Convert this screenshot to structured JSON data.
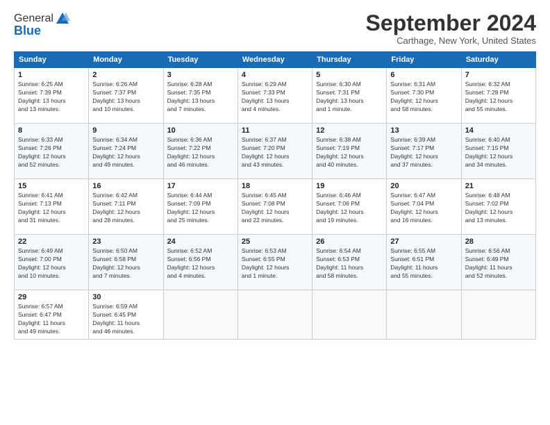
{
  "header": {
    "logo_general": "General",
    "logo_blue": "Blue",
    "month_title": "September 2024",
    "location": "Carthage, New York, United States"
  },
  "weekdays": [
    "Sunday",
    "Monday",
    "Tuesday",
    "Wednesday",
    "Thursday",
    "Friday",
    "Saturday"
  ],
  "weeks": [
    [
      {
        "day": "1",
        "info": "Sunrise: 6:25 AM\nSunset: 7:39 PM\nDaylight: 13 hours\nand 13 minutes."
      },
      {
        "day": "2",
        "info": "Sunrise: 6:26 AM\nSunset: 7:37 PM\nDaylight: 13 hours\nand 10 minutes."
      },
      {
        "day": "3",
        "info": "Sunrise: 6:28 AM\nSunset: 7:35 PM\nDaylight: 13 hours\nand 7 minutes."
      },
      {
        "day": "4",
        "info": "Sunrise: 6:29 AM\nSunset: 7:33 PM\nDaylight: 13 hours\nand 4 minutes."
      },
      {
        "day": "5",
        "info": "Sunrise: 6:30 AM\nSunset: 7:31 PM\nDaylight: 13 hours\nand 1 minute."
      },
      {
        "day": "6",
        "info": "Sunrise: 6:31 AM\nSunset: 7:30 PM\nDaylight: 12 hours\nand 58 minutes."
      },
      {
        "day": "7",
        "info": "Sunrise: 6:32 AM\nSunset: 7:28 PM\nDaylight: 12 hours\nand 55 minutes."
      }
    ],
    [
      {
        "day": "8",
        "info": "Sunrise: 6:33 AM\nSunset: 7:26 PM\nDaylight: 12 hours\nand 52 minutes."
      },
      {
        "day": "9",
        "info": "Sunrise: 6:34 AM\nSunset: 7:24 PM\nDaylight: 12 hours\nand 49 minutes."
      },
      {
        "day": "10",
        "info": "Sunrise: 6:36 AM\nSunset: 7:22 PM\nDaylight: 12 hours\nand 46 minutes."
      },
      {
        "day": "11",
        "info": "Sunrise: 6:37 AM\nSunset: 7:20 PM\nDaylight: 12 hours\nand 43 minutes."
      },
      {
        "day": "12",
        "info": "Sunrise: 6:38 AM\nSunset: 7:19 PM\nDaylight: 12 hours\nand 40 minutes."
      },
      {
        "day": "13",
        "info": "Sunrise: 6:39 AM\nSunset: 7:17 PM\nDaylight: 12 hours\nand 37 minutes."
      },
      {
        "day": "14",
        "info": "Sunrise: 6:40 AM\nSunset: 7:15 PM\nDaylight: 12 hours\nand 34 minutes."
      }
    ],
    [
      {
        "day": "15",
        "info": "Sunrise: 6:41 AM\nSunset: 7:13 PM\nDaylight: 12 hours\nand 31 minutes."
      },
      {
        "day": "16",
        "info": "Sunrise: 6:42 AM\nSunset: 7:11 PM\nDaylight: 12 hours\nand 28 minutes."
      },
      {
        "day": "17",
        "info": "Sunrise: 6:44 AM\nSunset: 7:09 PM\nDaylight: 12 hours\nand 25 minutes."
      },
      {
        "day": "18",
        "info": "Sunrise: 6:45 AM\nSunset: 7:08 PM\nDaylight: 12 hours\nand 22 minutes."
      },
      {
        "day": "19",
        "info": "Sunrise: 6:46 AM\nSunset: 7:06 PM\nDaylight: 12 hours\nand 19 minutes."
      },
      {
        "day": "20",
        "info": "Sunrise: 6:47 AM\nSunset: 7:04 PM\nDaylight: 12 hours\nand 16 minutes."
      },
      {
        "day": "21",
        "info": "Sunrise: 6:48 AM\nSunset: 7:02 PM\nDaylight: 12 hours\nand 13 minutes."
      }
    ],
    [
      {
        "day": "22",
        "info": "Sunrise: 6:49 AM\nSunset: 7:00 PM\nDaylight: 12 hours\nand 10 minutes."
      },
      {
        "day": "23",
        "info": "Sunrise: 6:50 AM\nSunset: 6:58 PM\nDaylight: 12 hours\nand 7 minutes."
      },
      {
        "day": "24",
        "info": "Sunrise: 6:52 AM\nSunset: 6:56 PM\nDaylight: 12 hours\nand 4 minutes."
      },
      {
        "day": "25",
        "info": "Sunrise: 6:53 AM\nSunset: 6:55 PM\nDaylight: 12 hours\nand 1 minute."
      },
      {
        "day": "26",
        "info": "Sunrise: 6:54 AM\nSunset: 6:53 PM\nDaylight: 11 hours\nand 58 minutes."
      },
      {
        "day": "27",
        "info": "Sunrise: 6:55 AM\nSunset: 6:51 PM\nDaylight: 11 hours\nand 55 minutes."
      },
      {
        "day": "28",
        "info": "Sunrise: 6:56 AM\nSunset: 6:49 PM\nDaylight: 11 hours\nand 52 minutes."
      }
    ],
    [
      {
        "day": "29",
        "info": "Sunrise: 6:57 AM\nSunset: 6:47 PM\nDaylight: 11 hours\nand 49 minutes."
      },
      {
        "day": "30",
        "info": "Sunrise: 6:59 AM\nSunset: 6:45 PM\nDaylight: 11 hours\nand 46 minutes."
      },
      null,
      null,
      null,
      null,
      null
    ]
  ]
}
